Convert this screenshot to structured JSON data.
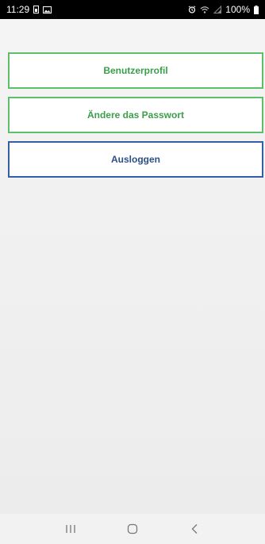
{
  "status_bar": {
    "time": "11:29",
    "battery": "100%",
    "icons_left": [
      "sim-card-icon",
      "image-icon"
    ],
    "icons_right": [
      "alarm-icon",
      "wifi-icon",
      "signal-icon",
      "battery-icon"
    ]
  },
  "menu": {
    "profile_label": "Benutzerprofil",
    "password_label": "Ändere das Passwort",
    "logout_label": "Ausloggen"
  },
  "nav_bar": {
    "buttons": [
      "recent-apps-icon",
      "home-icon",
      "back-icon"
    ]
  },
  "colors": {
    "status_bar_bg": "#000000",
    "green_accent": "#3a9e4a",
    "green_border": "#5cbf6a",
    "blue_accent": "#2a4e86",
    "blue_border": "#345ea8",
    "content_bg": "#f0f0f0"
  }
}
